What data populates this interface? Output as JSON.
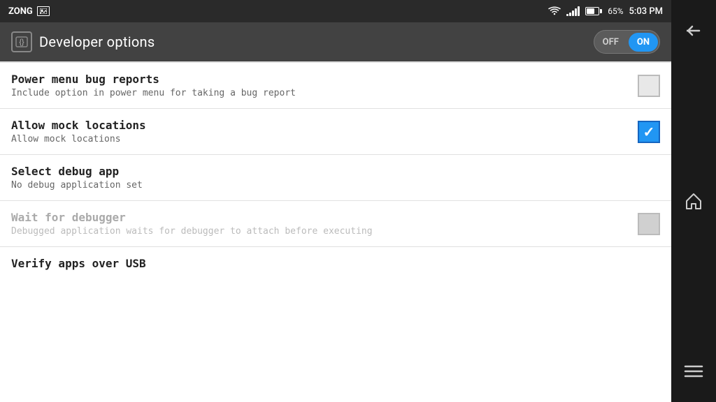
{
  "status_bar": {
    "carrier": "ZONG",
    "battery_percent": "65%",
    "time": "5:03 PM"
  },
  "toolbar": {
    "title": "Developer options",
    "toggle": {
      "off_label": "OFF",
      "on_label": "ON"
    }
  },
  "settings": [
    {
      "id": "power_menu_bug_reports",
      "title": "Power menu bug reports",
      "subtitle": "Include option in power menu for taking a bug report",
      "checked": false,
      "disabled": false
    },
    {
      "id": "allow_mock_locations",
      "title": "Allow mock locations",
      "subtitle": "Allow mock locations",
      "checked": true,
      "disabled": false
    },
    {
      "id": "select_debug_app",
      "title": "Select debug app",
      "subtitle": "No debug application set",
      "checked": null,
      "disabled": false
    },
    {
      "id": "wait_for_debugger",
      "title": "Wait for debugger",
      "subtitle": "Debugged application waits for debugger to attach before executing",
      "checked": false,
      "disabled": true
    },
    {
      "id": "verify_apps_usb",
      "title": "Verify apps over USB",
      "subtitle": "",
      "checked": false,
      "disabled": false,
      "partial": true
    }
  ],
  "nav": {
    "back_label": "back",
    "home_label": "home",
    "menu_label": "menu"
  },
  "colors": {
    "accent": "#2196F3",
    "toolbar_bg": "#424242",
    "status_bg": "#2a2a2a",
    "nav_bg": "#1a1a1a"
  }
}
